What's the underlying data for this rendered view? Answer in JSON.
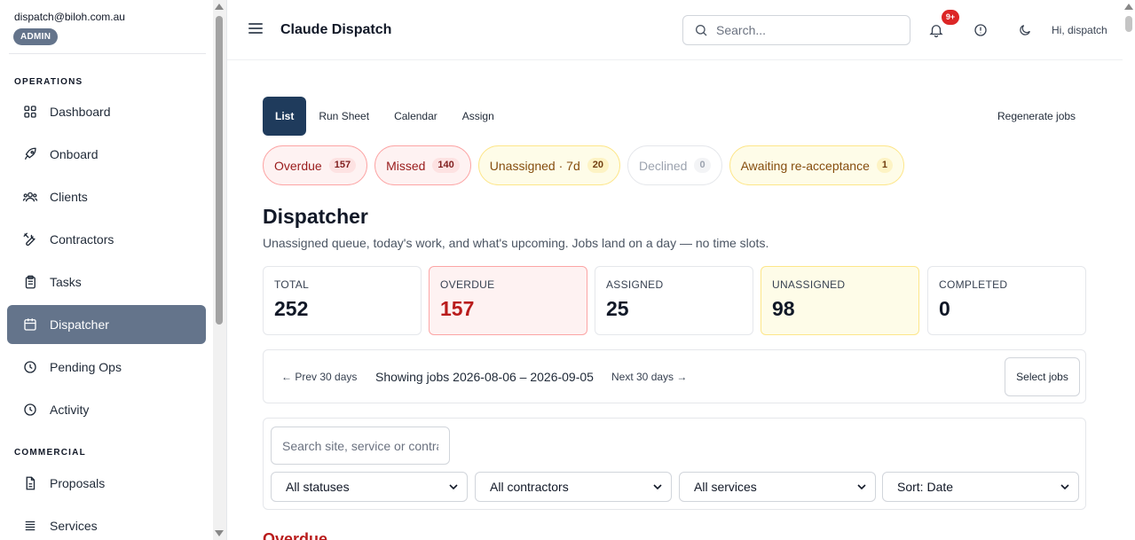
{
  "user": {
    "email": "dispatch@biloh.com.au",
    "role": "ADMIN"
  },
  "sidebar": {
    "sections": [
      "OPERATIONS",
      "COMMERCIAL"
    ],
    "items": [
      {
        "label": "Dashboard",
        "icon": "grid-icon"
      },
      {
        "label": "Onboard",
        "icon": "rocket-icon"
      },
      {
        "label": "Clients",
        "icon": "users-icon"
      },
      {
        "label": "Contractors",
        "icon": "wrench-icon"
      },
      {
        "label": "Tasks",
        "icon": "clipboard-icon"
      },
      {
        "label": "Dispatcher",
        "icon": "calendar-icon",
        "active": true
      },
      {
        "label": "Pending Ops",
        "icon": "clock-icon"
      },
      {
        "label": "Activity",
        "icon": "clock-icon"
      },
      {
        "label": "Proposals",
        "icon": "document-icon"
      },
      {
        "label": "Services",
        "icon": "list-icon"
      }
    ]
  },
  "header": {
    "title": "Claude Dispatch",
    "search_placeholder": "Search...",
    "notif_count": "9+",
    "greeting": "Hi, dispatch"
  },
  "tabs": [
    "List",
    "Run Sheet",
    "Calendar",
    "Assign"
  ],
  "regenerate_label": "Regenerate jobs",
  "pills": [
    {
      "label": "Overdue",
      "count": "157",
      "tone": "red"
    },
    {
      "label": "Missed",
      "count": "140",
      "tone": "red"
    },
    {
      "label": "Unassigned · 7d",
      "count": "20",
      "tone": "yellow"
    },
    {
      "label": "Declined",
      "count": "0",
      "tone": "gray"
    },
    {
      "label": "Awaiting re-acceptance",
      "count": "1",
      "tone": "yellow"
    }
  ],
  "page": {
    "title": "Dispatcher",
    "subtitle": "Unassigned queue, today's work, and what's upcoming. Jobs land on a day — no time slots."
  },
  "stats": [
    {
      "label": "TOTAL",
      "value": "252",
      "tone": "plain"
    },
    {
      "label": "OVERDUE",
      "value": "157",
      "tone": "red"
    },
    {
      "label": "ASSIGNED",
      "value": "25",
      "tone": "plain"
    },
    {
      "label": "UNASSIGNED",
      "value": "98",
      "tone": "yellow"
    },
    {
      "label": "COMPLETED",
      "value": "0",
      "tone": "plain"
    }
  ],
  "range": {
    "prev": "← Prev 30 days",
    "showing": "Showing jobs 2026-08-06 – 2026-09-05",
    "next": "Next 30 days →",
    "select_jobs": "Select jobs"
  },
  "filters": {
    "search_placeholder": "Search site, service or contractor",
    "statuses": "All statuses",
    "contractors": "All contractors",
    "services": "All services",
    "sort": "Sort: Date"
  },
  "section_heading": "Overdue",
  "colors": {
    "active_nav": "#64748b",
    "active_tab": "#1f3b5c",
    "danger": "#b91c1c",
    "badge": "#dc2626"
  }
}
